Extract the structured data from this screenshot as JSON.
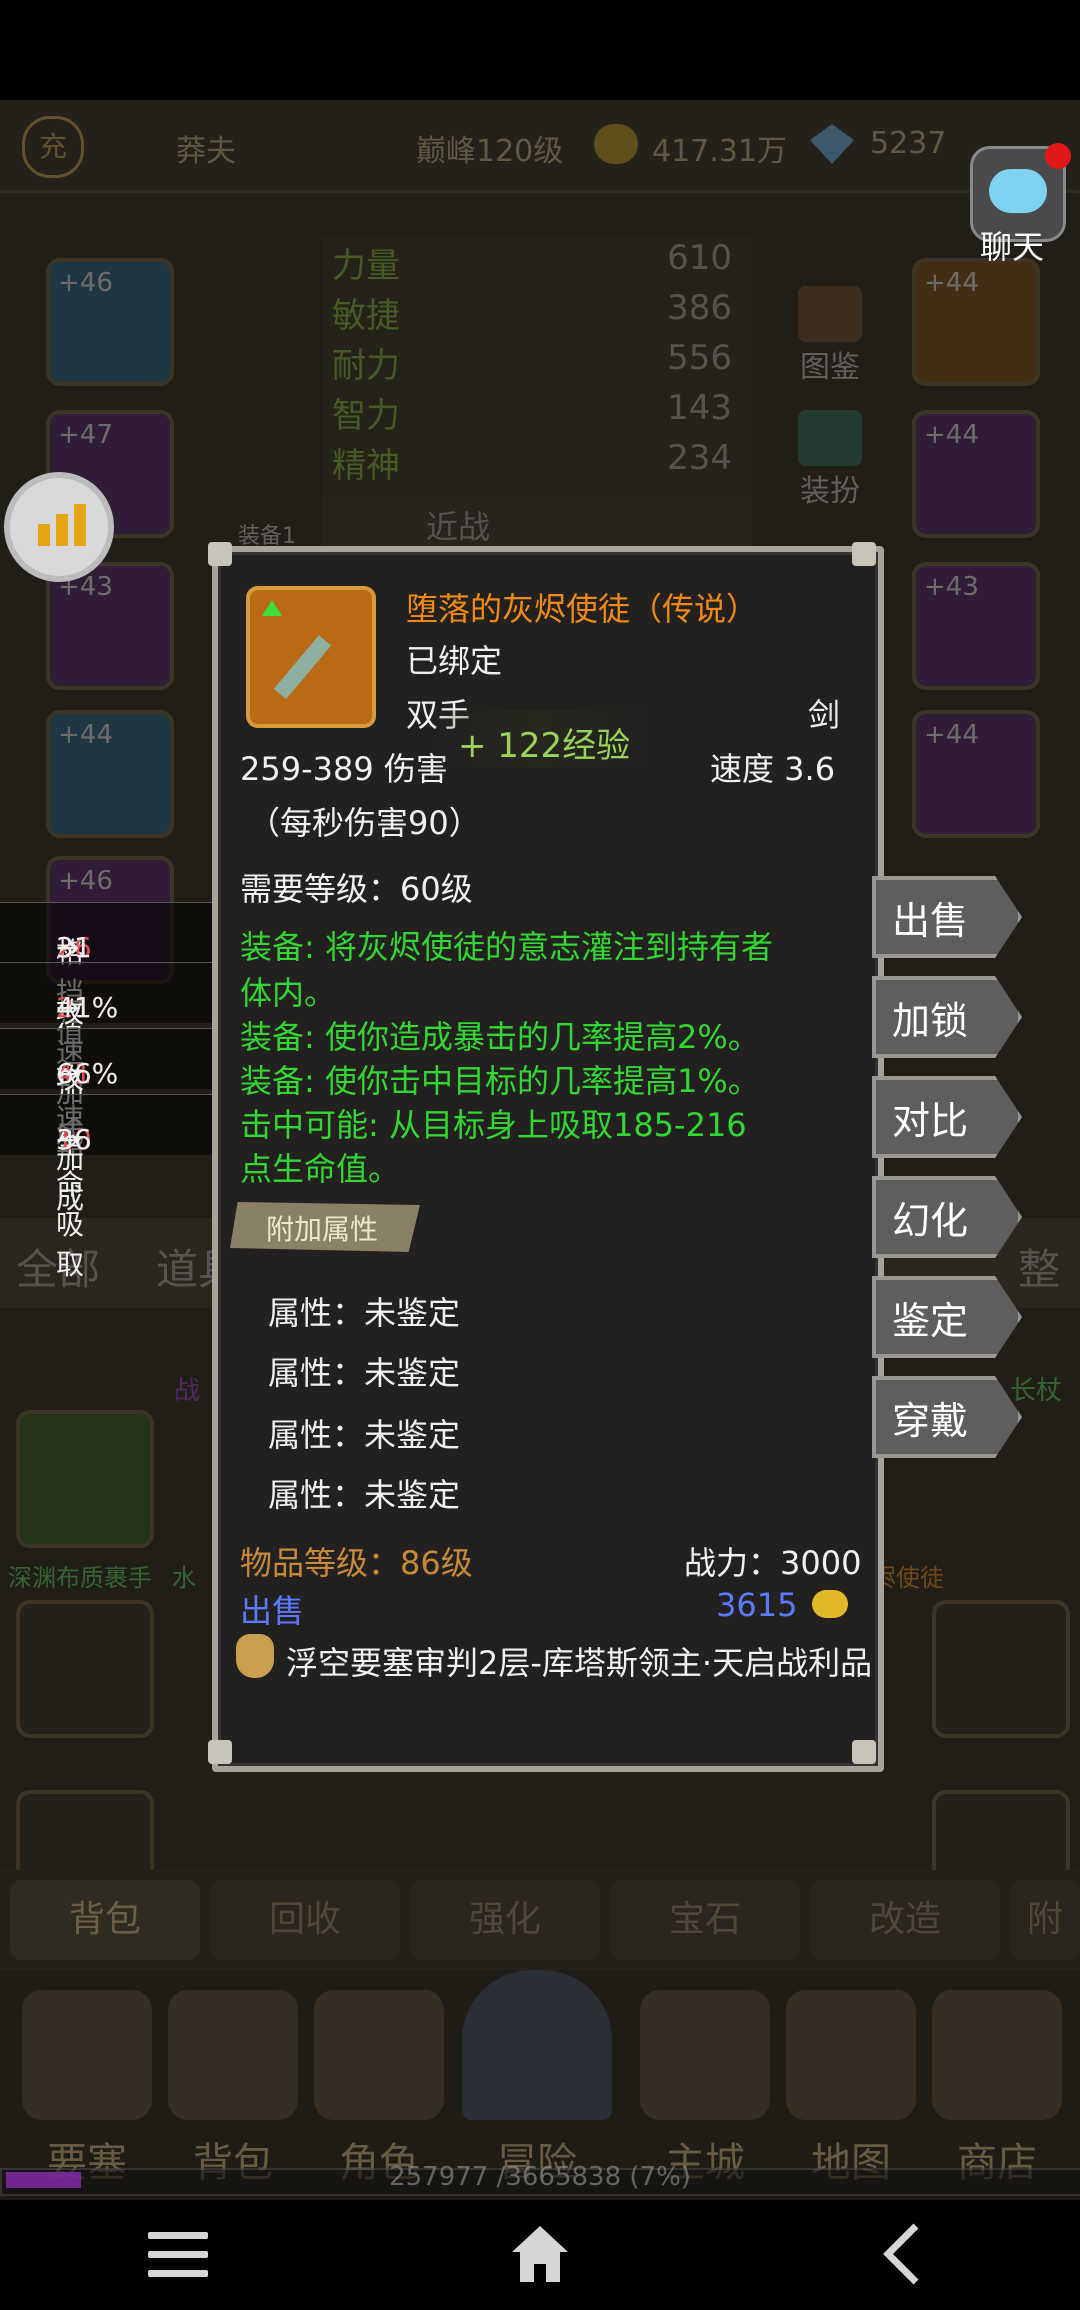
{
  "topbar": {
    "name": "莽夫",
    "level": "巅峰120级",
    "gold": "417.31万",
    "gems": "5237",
    "avatar_char": "充"
  },
  "chat": {
    "label": "聊天"
  },
  "stats": [
    {
      "name": "力量",
      "value": "610"
    },
    {
      "name": "敏捷",
      "value": "386"
    },
    {
      "name": "耐力",
      "value": "556"
    },
    {
      "name": "智力",
      "value": "143"
    },
    {
      "name": "精神",
      "value": "234"
    }
  ],
  "combat_type": "近战",
  "equip_tag": "装备1",
  "side_labels": {
    "codex": "图鉴",
    "outfit": "装扮"
  },
  "slot_levels": {
    "left": [
      "+46",
      "+47",
      "+43",
      "+44",
      "+46"
    ],
    "right": [
      "+44",
      "+44",
      "+43",
      "+44"
    ]
  },
  "compare": [
    {
      "name": "格挡值",
      "from": "26",
      "to": "31"
    },
    {
      "name": "攻速加成",
      "from": "21%",
      "to": "41%"
    },
    {
      "name": "攻速加成",
      "from": "41%",
      "to": "66%"
    },
    {
      "name": "生命吸取",
      "from": "10",
      "to": "36"
    }
  ],
  "arrow": "→",
  "filter": {
    "all": "全部",
    "props": "道具",
    "tidy": "整"
  },
  "bag_items": {
    "item1": "深渊布质裹手",
    "item1b": "水",
    "item2": "长杖",
    "item3": "烬使徒",
    "item4": "战"
  },
  "item": {
    "name": "堕落的灰烬使徒（传说）",
    "bound": "已绑定",
    "hand": "双手",
    "weapon_type": "剑",
    "damage": "259-389 伤害",
    "speed": "速度 3.6",
    "dps": "（每秒伤害90）",
    "exp_popup": "+ 122经验",
    "req_level": "需要等级：60级",
    "effects": [
      "装备: 将灰烬使徒的意志灌注到持有者",
      "体内。",
      "装备: 使你造成暴击的几率提高2%。",
      "装备: 使你击中目标的几率提高1%。",
      "击中可能: 从目标身上吸取185-216",
      "点生命值。"
    ],
    "extra_header": "附加属性",
    "attributes": [
      "属性：未鉴定",
      "属性：未鉴定",
      "属性：未鉴定",
      "属性：未鉴定"
    ],
    "item_level": "物品等级：86级",
    "power": "战力：3000",
    "sell_label": "出售",
    "sell_price": "3615",
    "source": "浮空要塞审判2层-库塔斯领主·天启战利品"
  },
  "actions": [
    "出售",
    "加锁",
    "对比",
    "幻化",
    "鉴定",
    "穿戴"
  ],
  "tabs": [
    "背包",
    "回收",
    "强化",
    "宝石",
    "改造",
    "附"
  ],
  "nav": [
    "要塞",
    "背包",
    "角色",
    "冒险",
    "主城",
    "地图",
    "商店"
  ],
  "exp": {
    "text": "257977 /3665838 (7%)",
    "fraction": 0.07
  },
  "colors": {
    "legendary": "#f08a14",
    "effect": "#33d633",
    "sell_price": "#5b7bff"
  }
}
